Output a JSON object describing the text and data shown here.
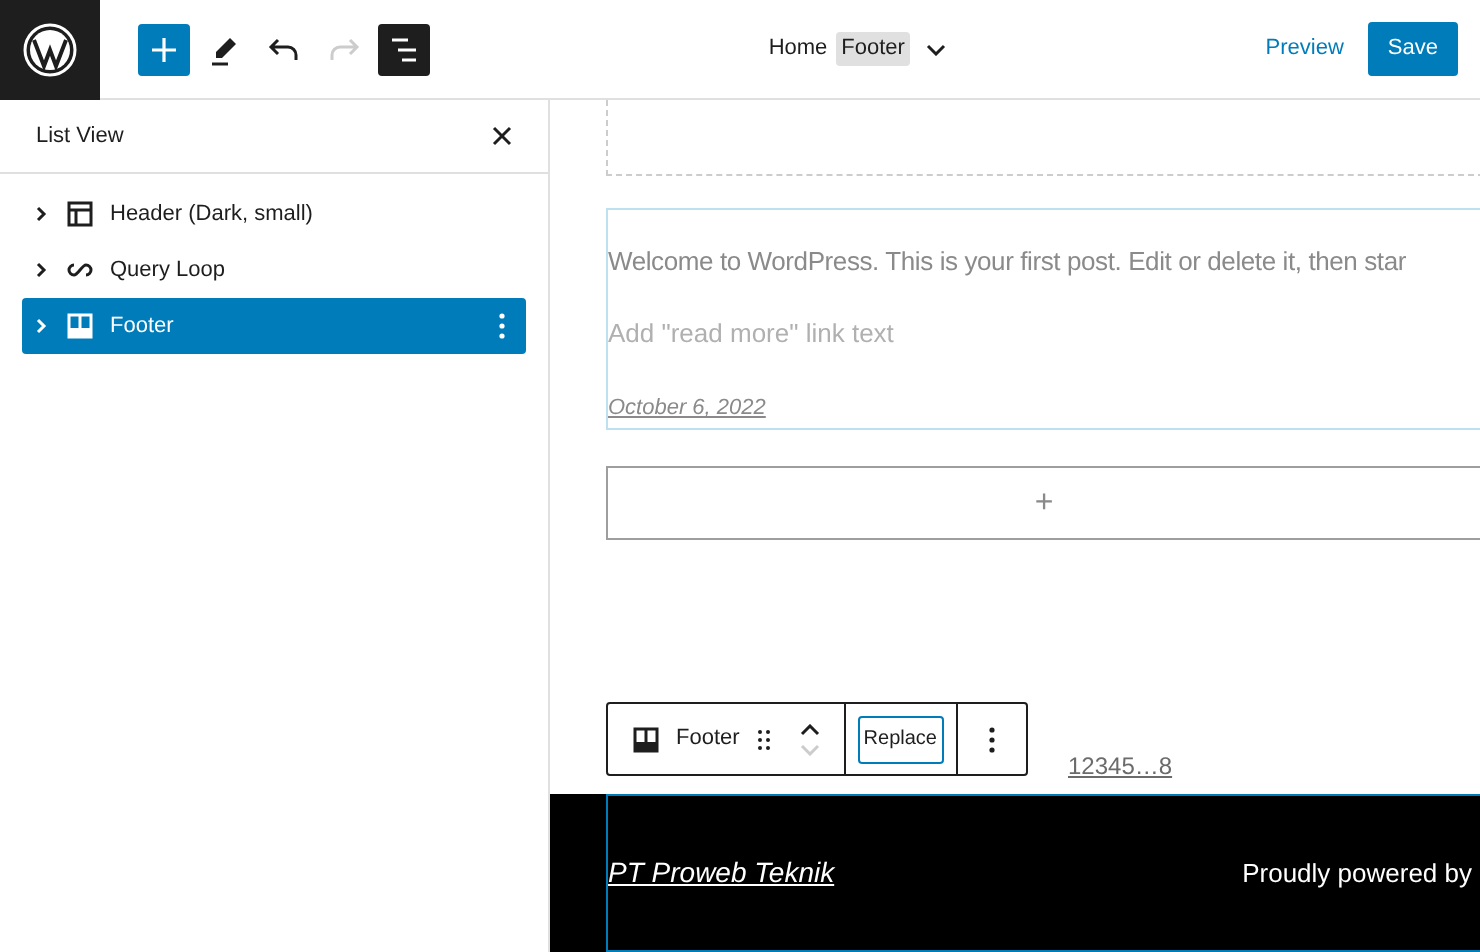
{
  "topbar": {
    "buttons": [
      {
        "kind": "add",
        "selected": true
      },
      {
        "kind": "edit",
        "selected": false
      },
      {
        "kind": "undo",
        "selected": false,
        "disabled": false
      },
      {
        "kind": "redo",
        "selected": false,
        "disabled": true
      },
      {
        "kind": "listview",
        "selected": true
      }
    ],
    "breadcrumb": [
      {
        "label": "Home",
        "current": false
      },
      {
        "label": "Footer",
        "current": true
      }
    ],
    "preview": "Preview",
    "save": "Save"
  },
  "list_view": {
    "title": "List View",
    "items": [
      {
        "label": "Header (Dark, small)",
        "kind": "header",
        "selected": false,
        "expanded": false
      },
      {
        "label": "Query Loop",
        "kind": "loop",
        "selected": false,
        "expanded": false
      },
      {
        "label": "Footer",
        "kind": "footer",
        "selected": true,
        "expanded": false
      }
    ]
  },
  "canvas": {
    "excerpt": "Welcome to WordPress. This is your first post. Edit or delete it, then star",
    "read_more_placeholder": "Add \"read more\" link text",
    "date": "October 6, 2022",
    "appender": "+",
    "block_toolbar": {
      "block": "Footer",
      "replace": "Replace"
    },
    "pagination": "12345…8",
    "footer": {
      "site": "PT Proweb Teknik",
      "credit": "Proudly powered by"
    }
  }
}
